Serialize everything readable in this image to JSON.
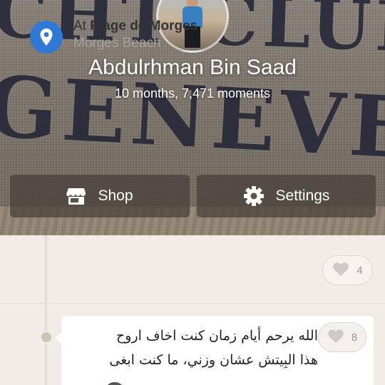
{
  "header": {
    "background_text_line1": "CHT CLUB",
    "background_text_line2": "GENEVE",
    "profile_name": "Abdulrhman Bin Saad",
    "profile_meta": "10 months, 7,471 moments",
    "buttons": {
      "shop_label": "Shop",
      "settings_label": "Settings"
    }
  },
  "feed": {
    "venue": {
      "prefix": "At",
      "name": "Plage de Morges",
      "subtitle": "Morges Beach",
      "likes": "4"
    },
    "tip": {
      "line1": "الله يرحم أيام زمان كنت اخاف اروح",
      "line2": "هذا البِيتش عشان وزني، ما كنت ابغى",
      "likes": "8"
    }
  },
  "colors": {
    "accent_blue": "#2f78d6",
    "feed_background": "#f1ece6",
    "button_background": "#463e37"
  },
  "icons": {
    "shop": "store-icon",
    "settings": "gear-icon",
    "location": "location-pin-icon",
    "like": "heart-icon"
  }
}
